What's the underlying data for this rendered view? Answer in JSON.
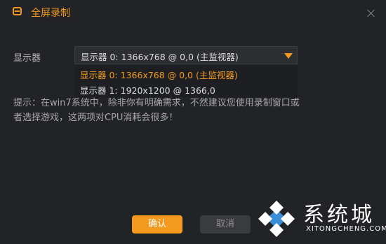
{
  "window": {
    "title": "全屏录制",
    "icon": "window-icon",
    "accent_color": "#f39a1e"
  },
  "monitor": {
    "label": "显示器",
    "selected_value": "显示器 0: 1366x768 @ 0,0 (主监视器)",
    "options": [
      "显示器 0: 1366x768 @ 0,0 (主监视器)",
      "显示器 1: 1920x1200 @ 1366,0"
    ]
  },
  "hint": {
    "line1": "提示：在win7系统中，除非你有明确需求，不然建议您使用录制窗口或",
    "line2": "者选择游戏，这两项对CPU消耗会很多！"
  },
  "buttons": {
    "confirm": "确认",
    "cancel": "取消"
  },
  "watermark": {
    "name": "系统城",
    "url": "XITONGCHENG.COM"
  }
}
